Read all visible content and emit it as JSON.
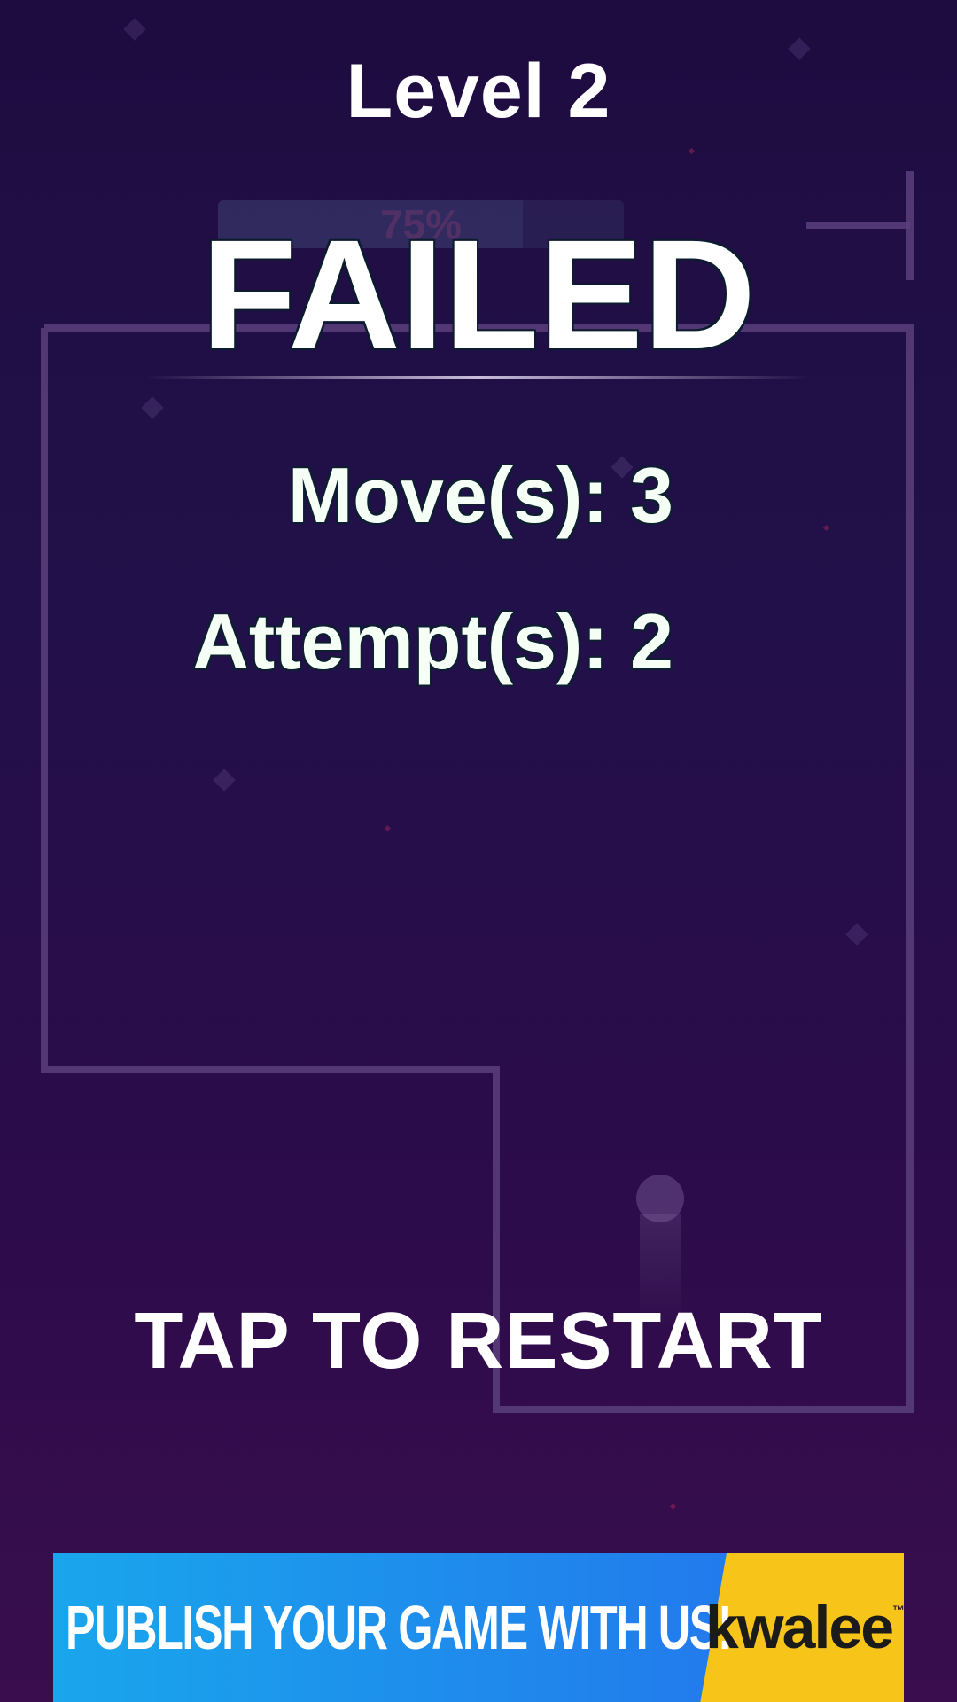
{
  "game": {
    "level_title": "Level 2",
    "progress_text": "75%",
    "progress_fraction": 0.75,
    "status_title": "FAILED",
    "moves_text": "Move(s): 3",
    "attempts_text": "Attempt(s): 2",
    "restart_prompt": "TAP TO RESTART"
  },
  "ad": {
    "slogan": "PUBLISH YOUR GAME WITH US!",
    "logo_text": "kwalee"
  },
  "colors": {
    "background_top": "#1e0c40",
    "background_bottom": "#390d4e",
    "ad_blue": "#1e8fec",
    "ad_yellow": "#f7c51a",
    "outline": "#5b3f7c"
  }
}
